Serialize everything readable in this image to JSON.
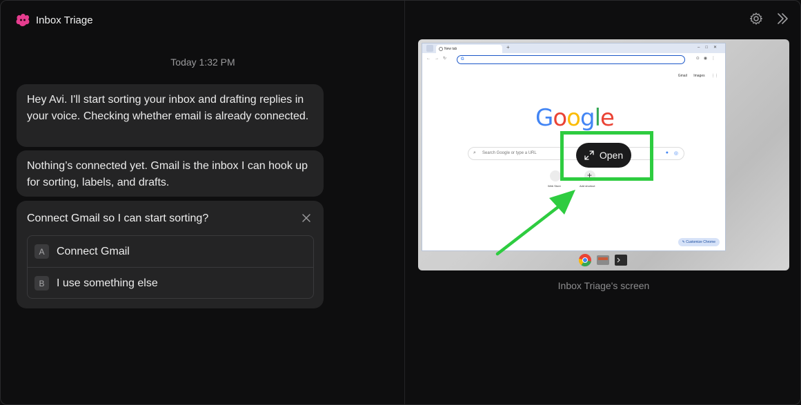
{
  "app": {
    "title": "Inbox Triage",
    "accent_color": "#e63d8f"
  },
  "chat": {
    "timestamp": "Today 1:32 PM",
    "messages": [
      {
        "text": "Hey Avi. I'll start sorting your inbox and drafting replies in your voice. Checking whether email is already connected."
      },
      {
        "text": "Nothing’s connected yet. Gmail is the inbox I can hook up for sorting, labels, and drafts."
      }
    ],
    "prompt": {
      "title": "Connect Gmail so I can start sorting?",
      "close_icon": "close-icon",
      "options": [
        {
          "key": "A",
          "label": "Connect Gmail"
        },
        {
          "key": "B",
          "label": "I use something else"
        }
      ]
    }
  },
  "right_pane": {
    "icons": [
      "gear-icon",
      "double-chevron-right-icon"
    ],
    "screen_caption": "Inbox Triage's screen",
    "open_button_label": "Open",
    "highlight_color": "#2ecc40"
  },
  "browser": {
    "tab_title": "New tab",
    "top_links": [
      "Gmail",
      "Images"
    ],
    "search_placeholder": "Search Google or type a URL",
    "shortcuts": [
      "Web Store",
      "Add shortcut"
    ],
    "customize_label": "Customize Chrome"
  }
}
